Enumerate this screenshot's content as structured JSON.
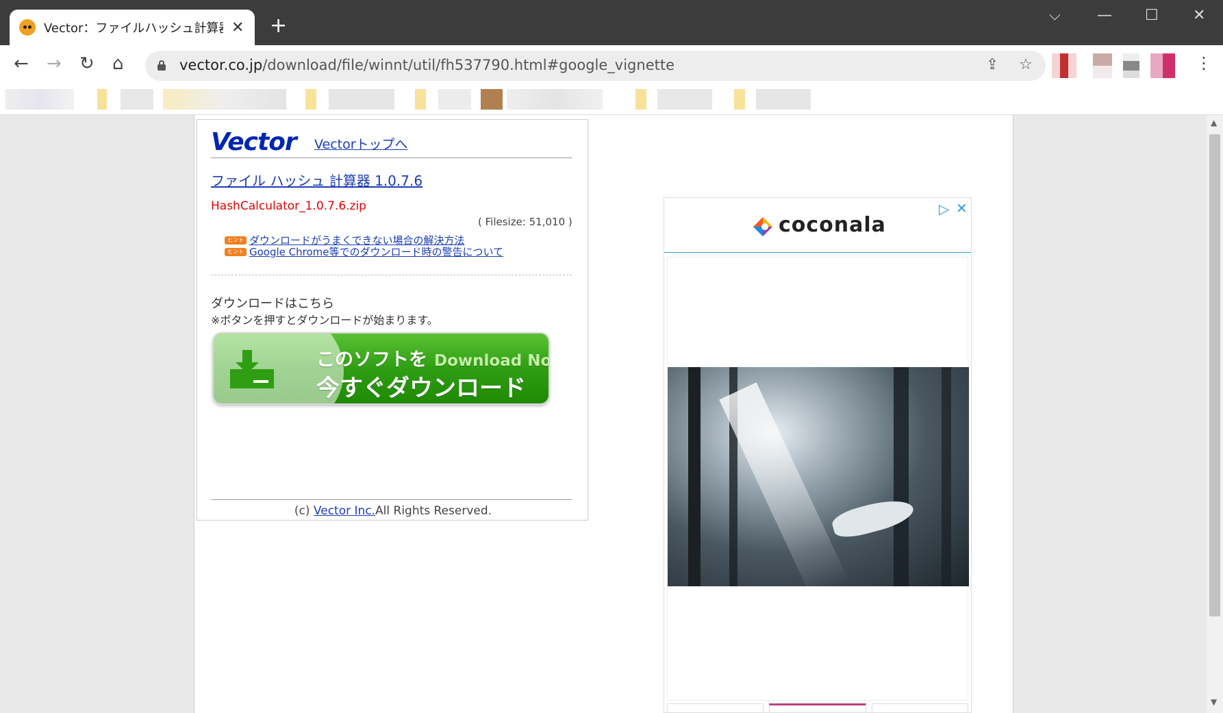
{
  "browser": {
    "tab": {
      "title": "Vector：ファイルハッシュ計算器 (Wi",
      "close": "✕"
    },
    "new_tab": "+",
    "window_controls": {
      "dropdown": "⌵",
      "minimize": "—",
      "maximize": "☐",
      "close": "✕"
    },
    "nav": {
      "back": "←",
      "forward": "→",
      "reload": "↻",
      "home": "⌂"
    },
    "url": {
      "domain": "vector.co.jp",
      "path": "/download/file/winnt/util/fh537790.html#google_vignette"
    },
    "omnibox_icons": {
      "share": "⇪",
      "star": "☆"
    },
    "menu": "⋮"
  },
  "page": {
    "logo": "Vector",
    "top_link": "Vectorトップへ",
    "software_title": "ファイル ハッシュ 計算器 1.0.7.6",
    "filename": "HashCalculator_1.0.7.6.zip",
    "filesize": "( Filesize: 51,010 )",
    "hints": [
      {
        "badge": "ヒント",
        "text": "ダウンロードがうまくできない場合の解決方法"
      },
      {
        "badge": "ヒント",
        "text": "Google Chrome等でのダウンロード時の警告について"
      }
    ],
    "download_heading": "ダウンロードはこちら",
    "download_note": "※ボタンを押すとダウンロードが始まります。",
    "download_button": {
      "line1": "このソフトを",
      "line1_en": "Download Now",
      "line2": "今すぐダウンロード"
    },
    "footer": {
      "prefix": "(c) ",
      "link": "Vector Inc.",
      "suffix": "All Rights Reserved."
    }
  },
  "ad": {
    "brand": "coconala",
    "adchoices_icon": "▷",
    "close": "✕"
  },
  "scrollbar": {
    "up": "▲",
    "down": "▼"
  },
  "colors": {
    "link": "#1a3cb5",
    "filename": "#e00000",
    "download_green": "#2f9e12",
    "ad_accent": "#2a9fd6",
    "logo_blue": "#0026b0"
  }
}
